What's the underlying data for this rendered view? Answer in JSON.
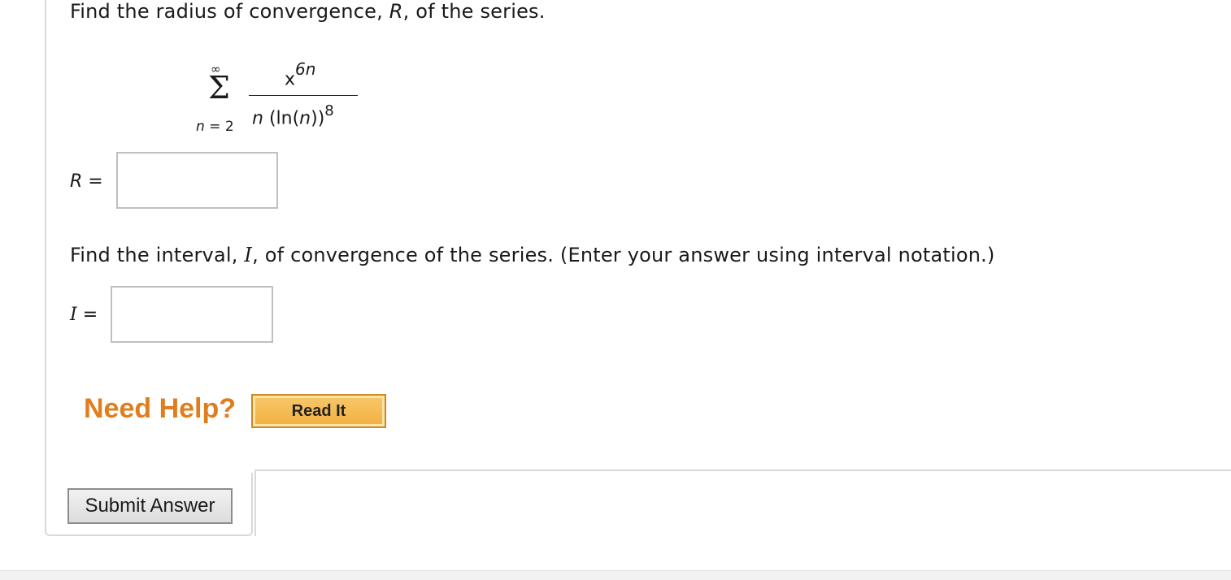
{
  "question": {
    "radius_prompt": {
      "before": "Find the radius of convergence, ",
      "var": "R",
      "after": ", of the series."
    },
    "series": {
      "sum_upper": "∞",
      "sigma": "Σ",
      "sum_lower_var": "n",
      "sum_lower_rest": " = 2",
      "numerator_base": "x",
      "numerator_exp": "6n",
      "denominator_n": "n",
      "denominator_ln_open": " (ln(",
      "denominator_ln_var": "n",
      "denominator_ln_close": "))",
      "denominator_exp": "8"
    },
    "radius_answer": {
      "label_var": "R",
      "label_eq": " =",
      "value": ""
    },
    "interval_prompt": {
      "before": "Find the interval, ",
      "var": "I",
      "after": ", of convergence of the series. (Enter your answer using interval notation.)"
    },
    "interval_answer": {
      "label_var": "I",
      "label_eq": " =",
      "value": ""
    }
  },
  "help": {
    "need_help_label": "Need Help?",
    "read_it_label": "Read It"
  },
  "actions": {
    "submit_label": "Submit Answer"
  },
  "colors": {
    "need_help": "#e07e1e",
    "read_it_bg": "#f2b040",
    "border": "#d9d9d9"
  }
}
